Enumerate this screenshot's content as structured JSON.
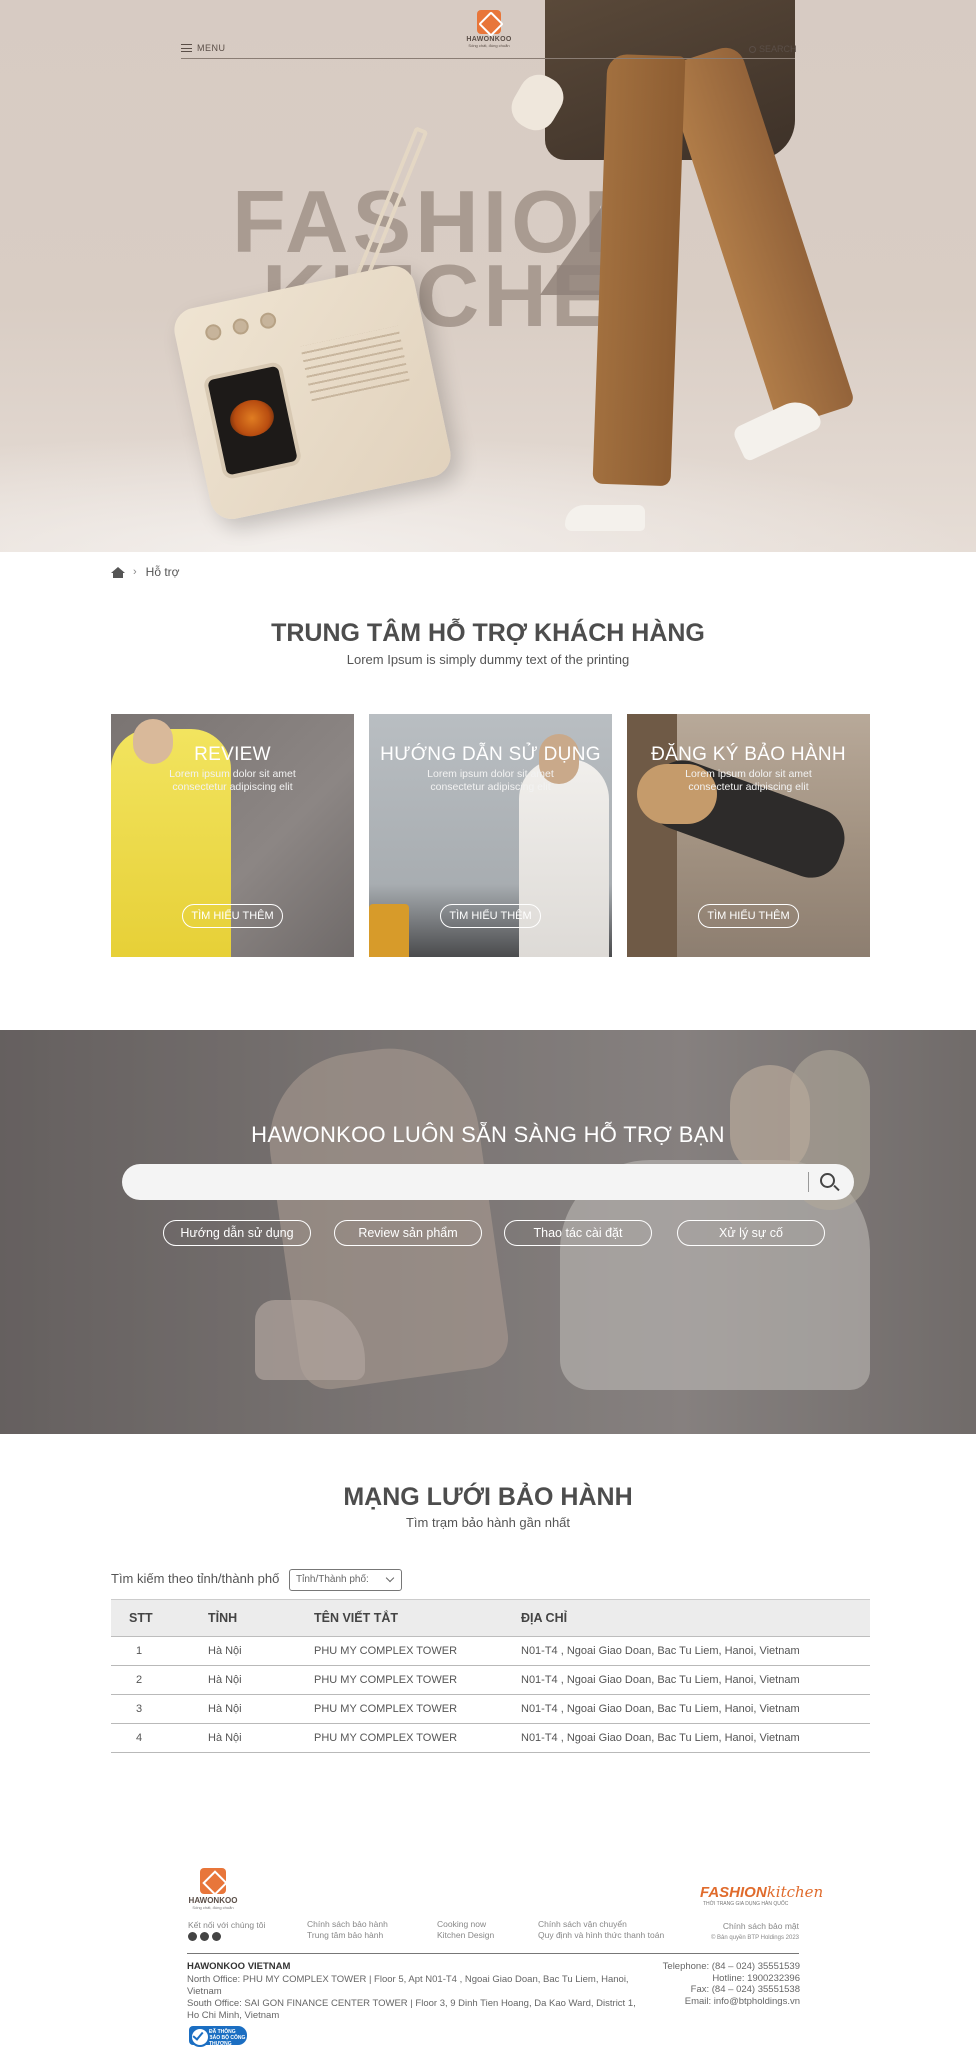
{
  "header": {
    "menu_label": "MENU",
    "logo_text": "HAWONKOO",
    "logo_tagline": "Sống chất, đúng chuẩn",
    "search_label": "SEARCH"
  },
  "hero": {
    "brand_line1": "FASHION",
    "brand_line2": "KITCHEN"
  },
  "breadcrumb": {
    "current": "Hỗ trợ"
  },
  "support_center": {
    "title": "TRUNG TÂM HỖ TRỢ KHÁCH HÀNG",
    "subtitle": "Lorem Ipsum is simply dummy text of the printing",
    "cards": [
      {
        "title": "REVIEW",
        "desc": "Lorem ipsum dolor sit amet consectetur adipiscing elit",
        "button": "TÌM HIỂU THÊM"
      },
      {
        "title": "HƯỚNG DẪN SỬ DỤNG",
        "desc": "Lorem ipsum dolor sit amet consectetur adipiscing elit",
        "button": "TÌM HIỂU THÊM"
      },
      {
        "title": "ĐĂNG KÝ BẢO HÀNH",
        "desc": "Lorem ipsum dolor sit amet consectetur adipiscing elit",
        "button": "TÌM HIỂU THÊM"
      }
    ]
  },
  "help": {
    "title": "HAWONKOO LUÔN SẴN SÀNG HỖ TRỢ BẠN",
    "search_value": "",
    "chips": [
      "Hướng dẫn sử dụng",
      "Review sản phẩm",
      "Thao tác cài đặt",
      "Xử lý sự cố"
    ]
  },
  "warranty": {
    "title": "MẠNG LƯỚI BẢO HÀNH",
    "subtitle": "Tìm trạm bảo hành gần nhất",
    "filter_label": "Tìm kiếm theo tỉnh/thành phố",
    "select_value": "Tỉnh/Thành phố:",
    "columns": [
      "STT",
      "TỈNH",
      "TÊN VIẾT TẮT",
      "ĐỊA CHỈ"
    ],
    "rows": [
      [
        "1",
        "Hà Nội",
        "PHU MY COMPLEX TOWER",
        "N01-T4 , Ngoai Giao Doan, Bac Tu Liem, Hanoi, Vietnam"
      ],
      [
        "2",
        "Hà Nội",
        "PHU MY COMPLEX TOWER",
        "N01-T4 , Ngoai Giao Doan, Bac Tu Liem, Hanoi, Vietnam"
      ],
      [
        "3",
        "Hà Nội",
        "PHU MY COMPLEX TOWER",
        "N01-T4 , Ngoai Giao Doan, Bac Tu Liem, Hanoi, Vietnam"
      ],
      [
        "4",
        "Hà Nội",
        "PHU MY COMPLEX TOWER",
        "N01-T4 , Ngoai Giao Doan, Bac Tu Liem, Hanoi, Vietnam"
      ]
    ]
  },
  "footer": {
    "logo_text": "HAWONKOO",
    "logo_tagline": "Sống chất, đúng chuẩn",
    "fk_logo_a": "FASHION",
    "fk_logo_b": "kitchen",
    "fk_tagline": "THỜI TRANG GIA DỤNG HÀN QUỐC",
    "connect": "Kết nối với chúng tôi",
    "links_col1": [
      "Chính sách bảo hành",
      "Trung tâm bảo hành"
    ],
    "links_col2": [
      "Cooking now",
      "Kitchen Design"
    ],
    "links_col3": [
      "Chính sách vận chuyển",
      "Quy định và hình thức thanh toán"
    ],
    "privacy": "Chính sách bảo mật",
    "copyright": "© Bản quyền BTP Holdings 2023",
    "company": "HAWONKOO VIETNAM",
    "north_office": "North Office: PHU MY COMPLEX TOWER | Floor 5, Apt N01-T4 , Ngoai Giao Doan, Bac Tu Liem, Hanoi, Vietnam",
    "south_office": "South Office: SAI GON FINANCE CENTER TOWER | Floor 3, 9 Dinh Tien Hoang, Da Kao Ward, District 1, Ho Chi Minh, Vietnam",
    "telephone": "Telephone: (84 – 024) 35551539",
    "hotline": "Hotline: 1900232396",
    "fax": "Fax: (84 – 024) 35551538",
    "email": "Email: info@btpholdings.vn",
    "badge_text": "ĐÃ THÔNG BÁO BỘ CÔNG THƯƠNG"
  },
  "colors": {
    "brand_orange": "#e8763a",
    "text_dark": "#4d4d4d",
    "badge_blue": "#1b6ec2"
  }
}
